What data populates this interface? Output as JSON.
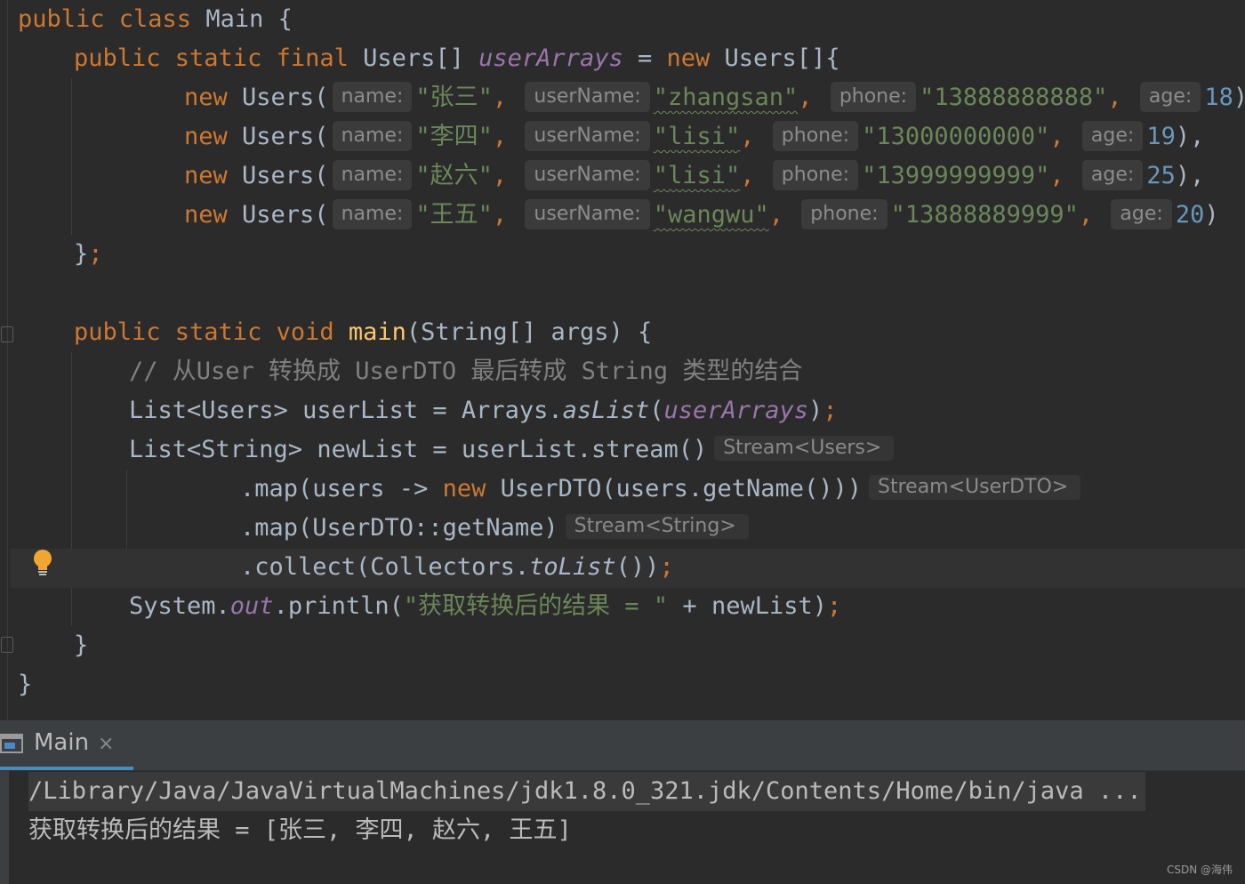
{
  "editor": {
    "l1": {
      "kw": "public class ",
      "rest": "Main {"
    },
    "l2": {
      "kw": "public static final ",
      "type": "Users[] ",
      "field": "userArrays",
      "eq": " = ",
      "new": "new ",
      "rest": "Users[]{"
    },
    "rows": [
      {
        "new": "new ",
        "call": "Users(",
        "name_hint": "name:",
        "name": "\"张三\"",
        "username_hint": "userName:",
        "username": "\"zhangsan\"",
        "phone_hint": "phone:",
        "phone": "\"13888888888\"",
        "age_hint": "age:",
        "age": "18",
        "end": "),"
      },
      {
        "new": "new ",
        "call": "Users(",
        "name_hint": "name:",
        "name": "\"李四\"",
        "username_hint": "userName:",
        "username": "\"lisi\"",
        "phone_hint": "phone:",
        "phone": "\"13000000000\"",
        "age_hint": "age:",
        "age": "19",
        "end": "),"
      },
      {
        "new": "new ",
        "call": "Users(",
        "name_hint": "name:",
        "name": "\"赵六\"",
        "username_hint": "userName:",
        "username": "\"lisi\"",
        "phone_hint": "phone:",
        "phone": "\"13999999999\"",
        "age_hint": "age:",
        "age": "25",
        "end": "),"
      },
      {
        "new": "new ",
        "call": "Users(",
        "name_hint": "name:",
        "name": "\"王五\"",
        "username_hint": "userName:",
        "username": "\"wangwu\"",
        "phone_hint": "phone:",
        "phone": "\"13888889999\"",
        "age_hint": "age:",
        "age": "20",
        "end": ")"
      }
    ],
    "l7": {
      "brace": "}",
      "semi": ";"
    },
    "l9": {
      "kw": "public static void ",
      "method": "main",
      "rest": "(String[] args) {"
    },
    "l10": {
      "comment": "// 从User 转换成 UserDTO 最后转成 String 类型的结合"
    },
    "l11": {
      "a": "List<Users> userList = Arrays.",
      "b": "asList",
      "c": "(",
      "field": "userArrays",
      "d": ")",
      "semi": ";"
    },
    "l12": {
      "code": "List<String> newList = userList.stream()",
      "hint": "Stream<Users>"
    },
    "l13": {
      "a": ".map(users -> ",
      "new": "new ",
      "b": "UserDTO(users.getName()))",
      "hint": "Stream<UserDTO>"
    },
    "l14": {
      "code": ".map(UserDTO::getName)",
      "hint": "Stream<String>"
    },
    "l15": {
      "a": ".collect(Collectors.",
      "b": "toList",
      "c": "())",
      "semi": ";"
    },
    "l16": {
      "a": "System.",
      "out": "out",
      "b": ".println(",
      "str": "\"获取转换后的结果 = \"",
      "c": " + newList)",
      "semi": ";"
    },
    "l17": {
      "brace": "}"
    },
    "l18": {
      "brace": "}"
    }
  },
  "run_panel": {
    "tab_label": "Main",
    "close_glyph": "×",
    "command": "/Library/Java/JavaVirtualMachines/jdk1.8.0_321.jdk/Contents/Home/bin/java ...",
    "output": "获取转换后的结果 = [张三, 李四, 赵六, 王五]"
  },
  "watermark": "CSDN @海伟",
  "colors": {
    "keyword": "#cc7832",
    "string": "#6a8759",
    "number": "#6897bb",
    "field": "#9876aa",
    "method": "#ffc66d",
    "comment": "#808080",
    "text": "#a9b7c6",
    "background": "#2b2b2b"
  }
}
